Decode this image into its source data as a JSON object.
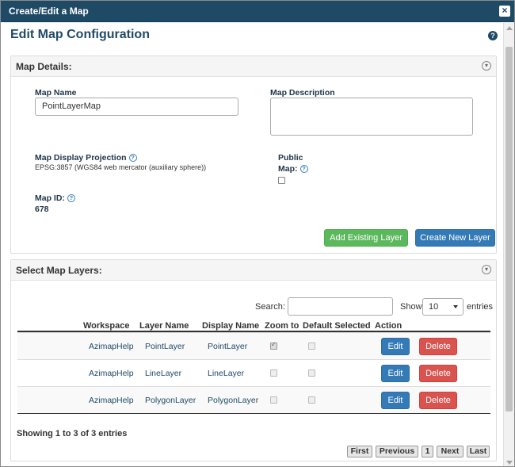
{
  "window": {
    "title": "Create/Edit a Map"
  },
  "page": {
    "title": "Edit Map Configuration"
  },
  "map_details": {
    "header": "Map Details:",
    "map_name_label": "Map Name",
    "map_name_value": "PointLayerMap",
    "map_description_label": "Map Description",
    "map_description_value": "",
    "projection_label": "Map Display Projection",
    "projection_value": "EPSG:3857 (WGS84 web mercator (auxiliary sphere))",
    "public_label_1": "Public",
    "public_label_2": "Map:",
    "public_checked": false,
    "map_id_label": "Map ID:",
    "map_id_value": "678",
    "add_existing_layer": "Add Existing Layer",
    "create_new_layer": "Create New Layer"
  },
  "layers": {
    "header": "Select Map Layers:",
    "search_label": "Search:",
    "search_value": "",
    "show_label": "Show",
    "show_value": "10",
    "entries_label": "entries",
    "columns": [
      "Workspace",
      "Layer Name",
      "Display Name",
      "Zoom to",
      "Default Selected",
      "Action"
    ],
    "rows": [
      {
        "workspace": "AzimapHelp",
        "layer_name": "PointLayer",
        "display_name": "PointLayer",
        "zoom_to": true,
        "default_selected": false,
        "edit": "Edit",
        "delete": "Delete"
      },
      {
        "workspace": "AzimapHelp",
        "layer_name": "LineLayer",
        "display_name": "LineLayer",
        "zoom_to": false,
        "default_selected": false,
        "edit": "Edit",
        "delete": "Delete"
      },
      {
        "workspace": "AzimapHelp",
        "layer_name": "PolygonLayer",
        "display_name": "PolygonLayer",
        "zoom_to": false,
        "default_selected": false,
        "edit": "Edit",
        "delete": "Delete"
      }
    ],
    "info": "Showing 1 to 3 of 3 entries",
    "pagination": {
      "first": "First",
      "previous": "Previous",
      "page": "1",
      "next": "Next",
      "last": "Last"
    }
  },
  "icons": {
    "close": "close-icon",
    "help": "help-icon",
    "collapse": "collapse-icon"
  },
  "colors": {
    "title_bar": "#1f4a66",
    "green_button": "#5cb85c",
    "blue_button": "#337ab7",
    "red_button": "#d9534f"
  }
}
